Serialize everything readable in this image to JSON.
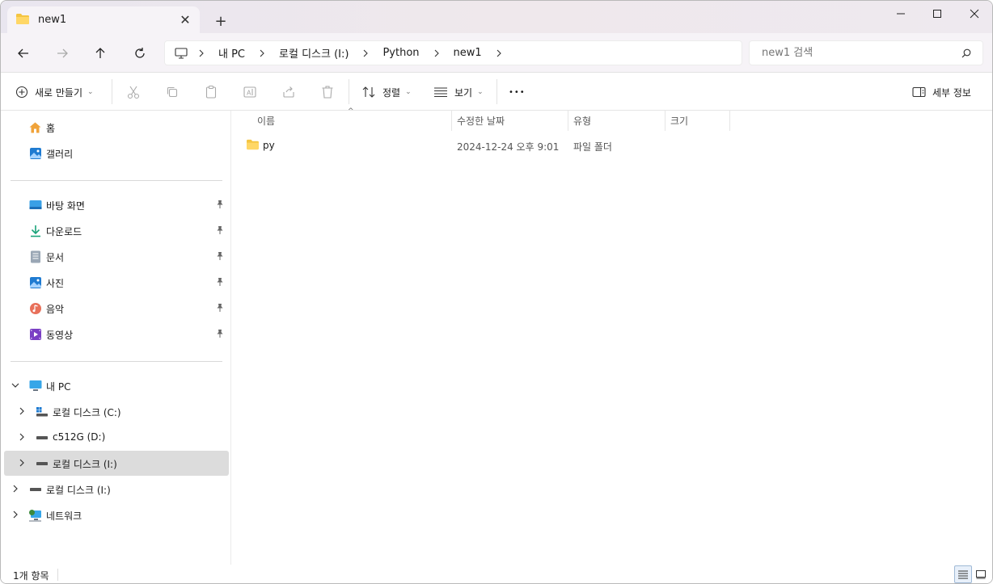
{
  "window": {
    "tab_title": "new1",
    "tab_close": "✕",
    "new_tab": "+",
    "minimize": "—",
    "maximize": "▢",
    "close": "✕"
  },
  "addressbar": {
    "breadcrumbs": [
      "내 PC",
      "로컬 디스크 (I:)",
      "Python",
      "new1"
    ],
    "search_placeholder": "new1 검색"
  },
  "toolbar": {
    "new_label": "새로 만들기",
    "sort_label": "정렬",
    "view_label": "보기",
    "more_label": "•••",
    "details_label": "세부 정보"
  },
  "sidebar": {
    "home": "홈",
    "gallery": "갤러리",
    "pinned": [
      {
        "label": "바탕 화면",
        "icon": "desktop-icon"
      },
      {
        "label": "다운로드",
        "icon": "download-icon"
      },
      {
        "label": "문서",
        "icon": "document-icon"
      },
      {
        "label": "사진",
        "icon": "pictures-icon"
      },
      {
        "label": "음악",
        "icon": "music-icon"
      },
      {
        "label": "동영상",
        "icon": "video-icon"
      }
    ],
    "this_pc": "내 PC",
    "drives": [
      {
        "label": "로컬 디스크 (C:)"
      },
      {
        "label": "c512G (D:)"
      },
      {
        "label": "로컬 디스크 (I:)"
      }
    ],
    "extra_drive": "로컬 디스크 (I:)",
    "network": "네트워크"
  },
  "content": {
    "columns": {
      "name": "이름",
      "date": "수정한 날짜",
      "type": "유형",
      "size": "크기"
    },
    "rows": [
      {
        "name": "py",
        "date": "2024-12-24 오후 9:01",
        "type": "파일 폴더",
        "size": ""
      }
    ]
  },
  "status": {
    "item_count": "1개 항목"
  },
  "colors": {
    "folder_yellow": "#f4c542",
    "selected_bg": "#dcdcdc",
    "accent_blue": "#1a73c8"
  }
}
